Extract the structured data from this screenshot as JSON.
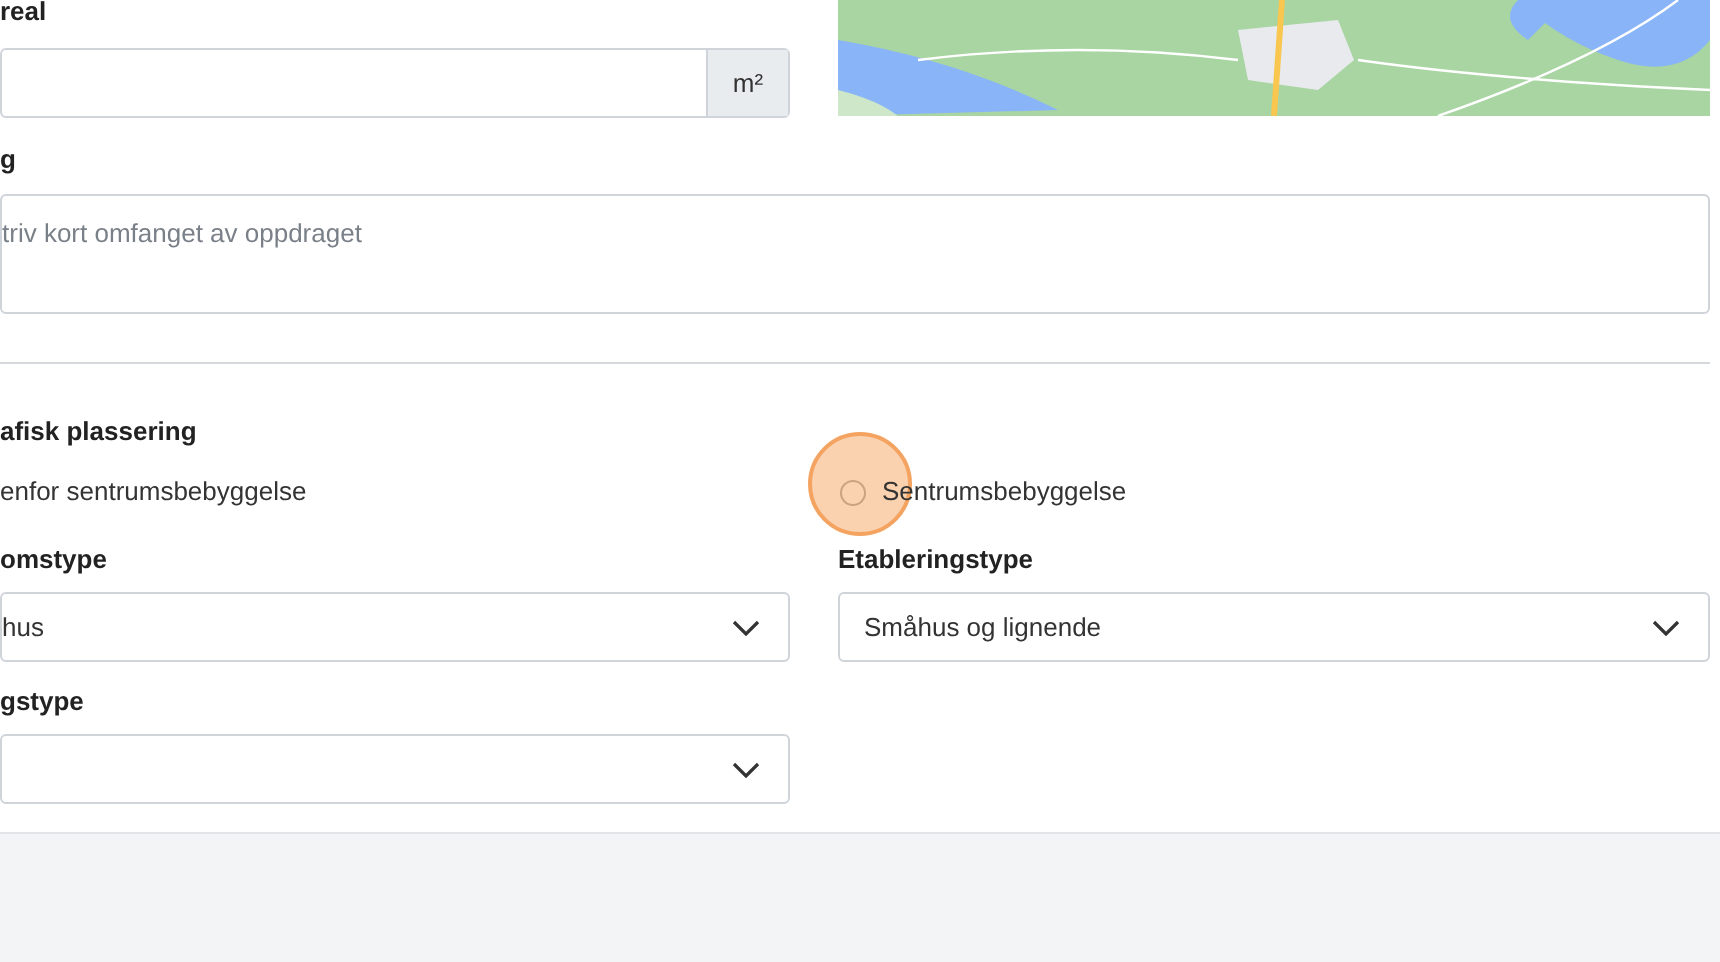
{
  "area": {
    "label": "real",
    "unit": "m²"
  },
  "description": {
    "label": "g",
    "placeholder": "triv kort omfanget av oppdraget"
  },
  "placement": {
    "label": "afisk plassering",
    "options": [
      {
        "label": "enfor sentrumsbebyggelse"
      },
      {
        "label": "Sentrumsbebyggelse",
        "selected": false
      }
    ]
  },
  "selects": [
    {
      "label": "omstype",
      "value": "hus"
    },
    {
      "label": "Etableringstype",
      "value": "Småhus og lignende"
    },
    {
      "label": "gstype"
    }
  ],
  "click_marker": {
    "on": true
  }
}
